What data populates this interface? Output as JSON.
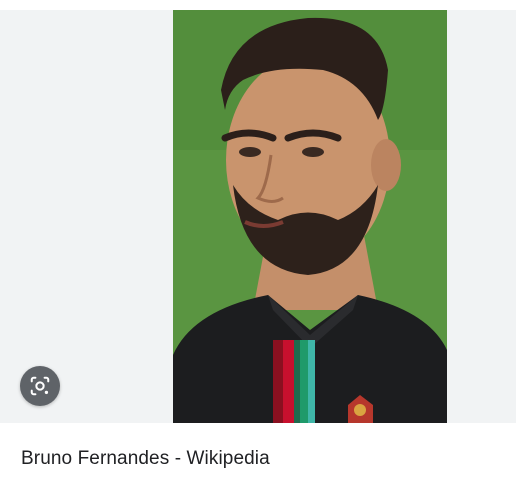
{
  "result": {
    "caption": "Bruno Fernandes - Wikipedia",
    "lens_icon": "google-lens-icon",
    "image_alt": "Bruno Fernandes"
  },
  "colors": {
    "panel_background": "#f1f3f4",
    "lens_button": "#5f6368",
    "caption_text": "#202124",
    "pitch_green": "#5e9a44",
    "jersey": "#1c1d1f",
    "stripe_red": "#c8102e",
    "stripe_green": "#1f9a6a",
    "stripe_teal": "#3fb6a8"
  }
}
